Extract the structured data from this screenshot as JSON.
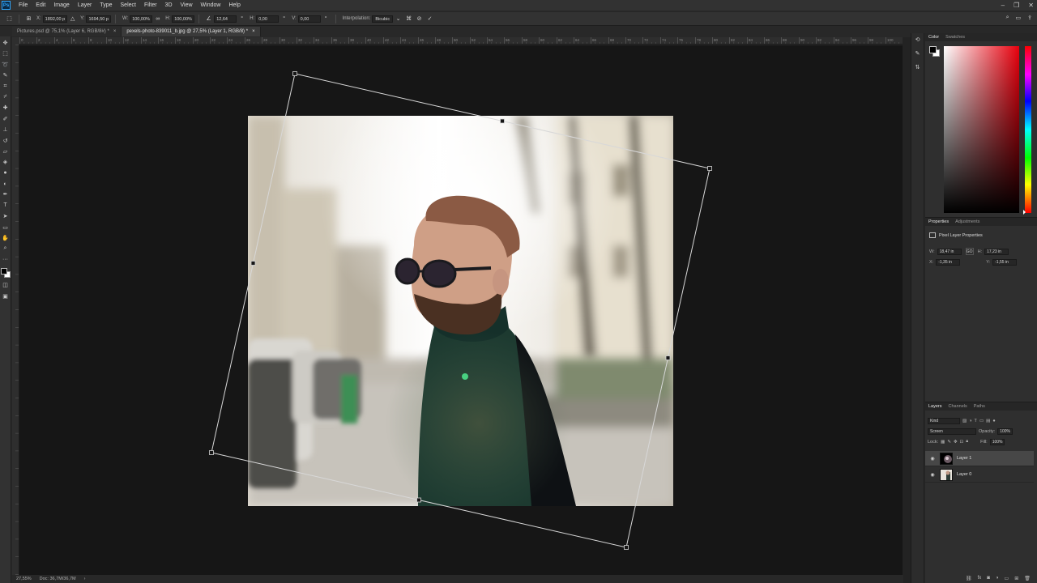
{
  "app": {
    "logo": "Ps"
  },
  "menu": [
    "File",
    "Edit",
    "Image",
    "Layer",
    "Type",
    "Select",
    "Filter",
    "3D",
    "View",
    "Window",
    "Help"
  ],
  "window_controls": [
    "–",
    "❐",
    "✕"
  ],
  "options": {
    "x_label": "X:",
    "x_value": "1892,00 p",
    "y_label": "Y:",
    "y_value": "1694,50 p",
    "w_label": "W:",
    "w_value": "100,00%",
    "h_label": "H:",
    "h_value": "100,00%",
    "angle_value": "12,64",
    "hskew_label": "H:",
    "hskew_value": "0,00",
    "vskew_label": "V:",
    "vskew_value": "0,00",
    "interp_label": "Interpolation:",
    "interp_value": "Bicubic"
  },
  "tabs": [
    {
      "label": "Pictures.psd @ 75,1% (Layer 6, RGB/8#) *"
    },
    {
      "label": "pexels-photo-839011_b.jpg @ 27,5% (Layer 1, RGB/8) *"
    }
  ],
  "status": {
    "zoom": "27,55%",
    "doc": "Doc: 36,7M/36,7M"
  },
  "color_panel": {
    "tabs": [
      "Color",
      "Swatches"
    ]
  },
  "properties_panel": {
    "tabs": [
      "Properties",
      "Adjustments"
    ],
    "title": "Pixel Layer Properties",
    "w_label": "W:",
    "w_value": "18,47 in",
    "h_label": "H:",
    "h_value": "17,23 in",
    "x_label": "X:",
    "x_value": "-1,35 in",
    "y_label": "Y:",
    "y_value": "-1,55 in",
    "link": "GO"
  },
  "layers_panel": {
    "tabs": [
      "Layers",
      "Channels",
      "Paths"
    ],
    "kind": "Kind",
    "blend_mode": "Screen",
    "opacity_label": "Opacity:",
    "opacity_value": "100%",
    "lock_label": "Lock:",
    "fill_label": "Fill:",
    "fill_value": "100%",
    "layers": [
      {
        "name": "Layer 1",
        "selected": true
      },
      {
        "name": "Layer 0",
        "selected": false
      }
    ]
  },
  "ruler_top_ticks": [
    "0",
    "2",
    "4",
    "6",
    "8",
    "10",
    "12",
    "14",
    "16",
    "18",
    "20",
    "22",
    "24",
    "26",
    "28",
    "30",
    "32",
    "34",
    "36",
    "38",
    "40",
    "42",
    "44",
    "46",
    "48",
    "50",
    "52",
    "54",
    "56",
    "58",
    "60",
    "62",
    "64",
    "66",
    "68",
    "70",
    "72",
    "74",
    "76",
    "78",
    "80",
    "82",
    "84",
    "86",
    "88",
    "90",
    "92",
    "94",
    "96",
    "98",
    "100"
  ]
}
